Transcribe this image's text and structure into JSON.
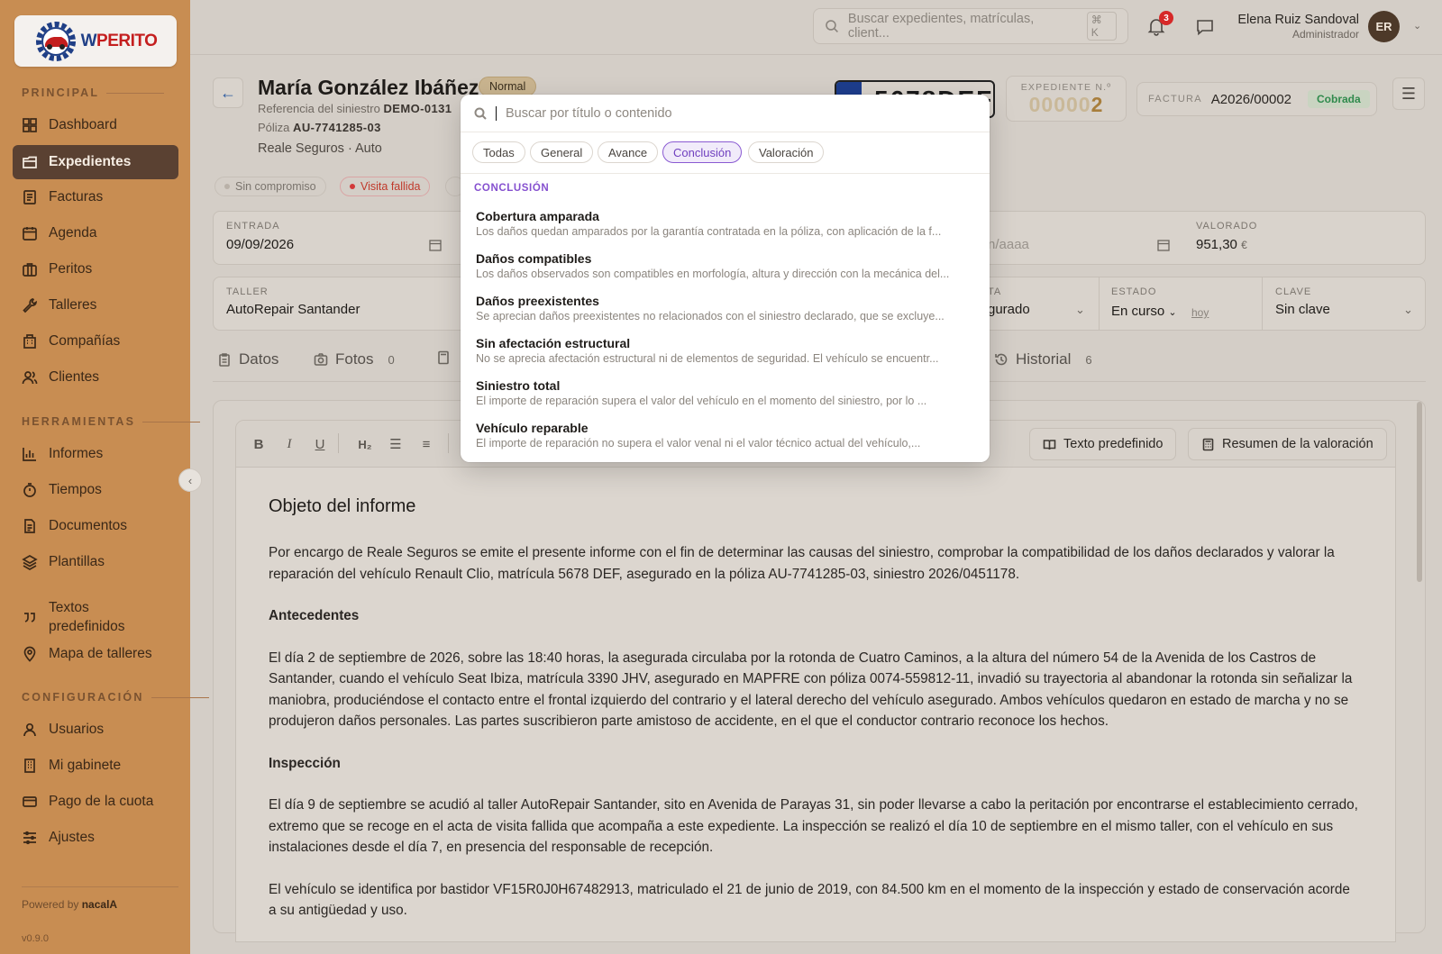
{
  "app": {
    "name": "WPERITO",
    "name_prefix": "W",
    "name_rest": "PERITO"
  },
  "sidebar": {
    "sections": [
      {
        "label": "PRINCIPAL",
        "items": [
          {
            "label": "Dashboard",
            "icon": "dashboard-icon"
          },
          {
            "label": "Expedientes",
            "icon": "folder-icon",
            "active": true
          },
          {
            "label": "Facturas",
            "icon": "invoice-icon"
          },
          {
            "label": "Agenda",
            "icon": "calendar-icon"
          },
          {
            "label": "Peritos",
            "icon": "briefcase-icon"
          },
          {
            "label": "Talleres",
            "icon": "wrench-icon"
          },
          {
            "label": "Compañías",
            "icon": "building-icon"
          },
          {
            "label": "Clientes",
            "icon": "users-icon"
          }
        ]
      },
      {
        "label": "HERRAMIENTAS",
        "items": [
          {
            "label": "Informes",
            "icon": "bar-chart-icon"
          },
          {
            "label": "Tiempos",
            "icon": "stopwatch-icon"
          },
          {
            "label": "Documentos",
            "icon": "document-icon"
          },
          {
            "label": "Plantillas",
            "icon": "layers-icon"
          },
          {
            "label": "Textos predefinidos",
            "icon": "quote-icon"
          },
          {
            "label": "Mapa de talleres",
            "icon": "map-pin-icon"
          }
        ]
      },
      {
        "label": "CONFIGURACIÓN",
        "items": [
          {
            "label": "Usuarios",
            "icon": "user-icon"
          },
          {
            "label": "Mi gabinete",
            "icon": "office-icon"
          },
          {
            "label": "Pago de la cuota",
            "icon": "credit-card-icon"
          },
          {
            "label": "Ajustes",
            "icon": "sliders-icon"
          }
        ]
      }
    ],
    "powered_by": "Powered by",
    "powered_brand": "nacalA",
    "version": "v0.9.0"
  },
  "topbar": {
    "search_placeholder": "Buscar expedientes, matrículas, client...",
    "search_shortcut": "⌘ K",
    "notifications_count": "3",
    "user_name": "Elena Ruiz Sandoval",
    "user_role": "Administrador",
    "user_initials": "ER"
  },
  "header": {
    "client_name": "María González Ibáñez",
    "priority": "Normal",
    "ref_label": "Referencia del siniestro",
    "ref_value": "DEMO-0131",
    "poliza_label": "Póliza",
    "poliza_value": "AU-7741285-03",
    "company": "Reale Seguros · Auto",
    "plate": "5678DEF",
    "expediente_label": "EXPEDIENTE N.º",
    "expediente_pad": "00000",
    "expediente_last": "2",
    "factura_label": "FACTURA",
    "factura_value": "A2026/00002",
    "factura_status": "Cobrada",
    "chips": [
      {
        "label": "Sin compromiso",
        "dot": "#b9b1a8",
        "color": "#7a746d"
      },
      {
        "label": "Visita fallida",
        "dot": "#d23a3a",
        "color": "#c0392b"
      }
    ]
  },
  "fields": {
    "entrada_label": "ENTRADA",
    "entrada_value": "09/09/2026",
    "date2_placeholder": "n/aaaa",
    "valorado_label": "VALORADO",
    "valorado_value": "951,30",
    "valorado_unit": "€",
    "taller_label": "TALLER",
    "taller_value": "AutoRepair Santander",
    "col4_label": "TA",
    "col4_value": "gurado",
    "estado_label": "ESTADO",
    "estado_value": "En curso",
    "estado_link": "hoy",
    "clave_label": "CLAVE",
    "clave_value": "Sin clave"
  },
  "tabs": [
    {
      "label": "Datos",
      "icon": "clipboard-icon"
    },
    {
      "label": "Fotos",
      "icon": "camera-icon",
      "count": "0"
    },
    {
      "label": "Historial",
      "icon": "history-icon",
      "count": "6"
    }
  ],
  "toolbar": {
    "bold": "B",
    "italic": "I",
    "underline": "U",
    "heading": "H₂",
    "texto_predefinido": "Texto predefinido",
    "resumen": "Resumen de la valoración"
  },
  "document": {
    "title": "Objeto del informe",
    "p1": "Por encargo de Reale Seguros se emite el presente informe con el fin de determinar las causas del siniestro, comprobar la compatibilidad de los daños declarados y valorar la reparación del vehículo Renault Clio, matrícula 5678 DEF, asegurado en la póliza AU-7741285-03, siniestro 2026/0451178.",
    "h_antecedentes": "Antecedentes",
    "p2": "El día 2 de septiembre de 2026, sobre las 18:40 horas, la asegurada circulaba por la rotonda de Cuatro Caminos, a la altura del número 54 de la Avenida de los Castros de Santander, cuando el vehículo Seat Ibiza, matrícula 3390 JHV, asegurado en MAPFRE con póliza 0074-559812-11, invadió su trayectoria al abandonar la rotonda sin señalizar la maniobra, produciéndose el contacto entre el frontal izquierdo del contrario y el lateral derecho del vehículo asegurado. Ambos vehículos quedaron en estado de marcha y no se produjeron daños personales. Las partes suscribieron parte amistoso de accidente, en el que el conductor contrario reconoce los hechos.",
    "h_inspeccion": "Inspección",
    "p3": "El día 9 de septiembre se acudió al taller AutoRepair Santander, sito en Avenida de Parayas 31, sin poder llevarse a cabo la peritación por encontrarse el establecimiento cerrado, extremo que se recoge en el acta de visita fallida que acompaña a este expediente. La inspección se realizó el día 10 de septiembre en el mismo taller, con el vehículo en sus instalaciones desde el día 7, en presencia del responsable de recepción.",
    "p4": "El vehículo se identifica por bastidor VF15R0J0H67482913, matriculado el 21 de junio de 2019, con 84.500 km en el momento de la inspección y estado de conservación acorde a su antigüedad y uso."
  },
  "popup": {
    "search_placeholder": "Buscar por título o contenido",
    "filters": [
      "Todas",
      "General",
      "Avance",
      "Conclusión",
      "Valoración"
    ],
    "active_filter": "Conclusión",
    "section": "CONCLUSIÓN",
    "items": [
      {
        "title": "Cobertura amparada",
        "desc": "Los daños quedan amparados por la garantía contratada en la póliza, con aplicación de la f..."
      },
      {
        "title": "Daños compatibles",
        "desc": "Los daños observados son compatibles en morfología, altura y dirección con la mecánica del..."
      },
      {
        "title": "Daños preexistentes",
        "desc": "Se aprecian daños preexistentes no relacionados con el siniestro declarado, que se excluye..."
      },
      {
        "title": "Sin afectación estructural",
        "desc": "No se aprecia afectación estructural ni de elementos de seguridad. El vehículo se encuentr..."
      },
      {
        "title": "Siniestro total",
        "desc": "El importe de reparación supera el valor del vehículo en el momento del siniestro, por lo ..."
      },
      {
        "title": "Vehículo reparable",
        "desc": "El importe de reparación no supera el valor venal ni el valor técnico actual del vehículo,..."
      }
    ]
  }
}
